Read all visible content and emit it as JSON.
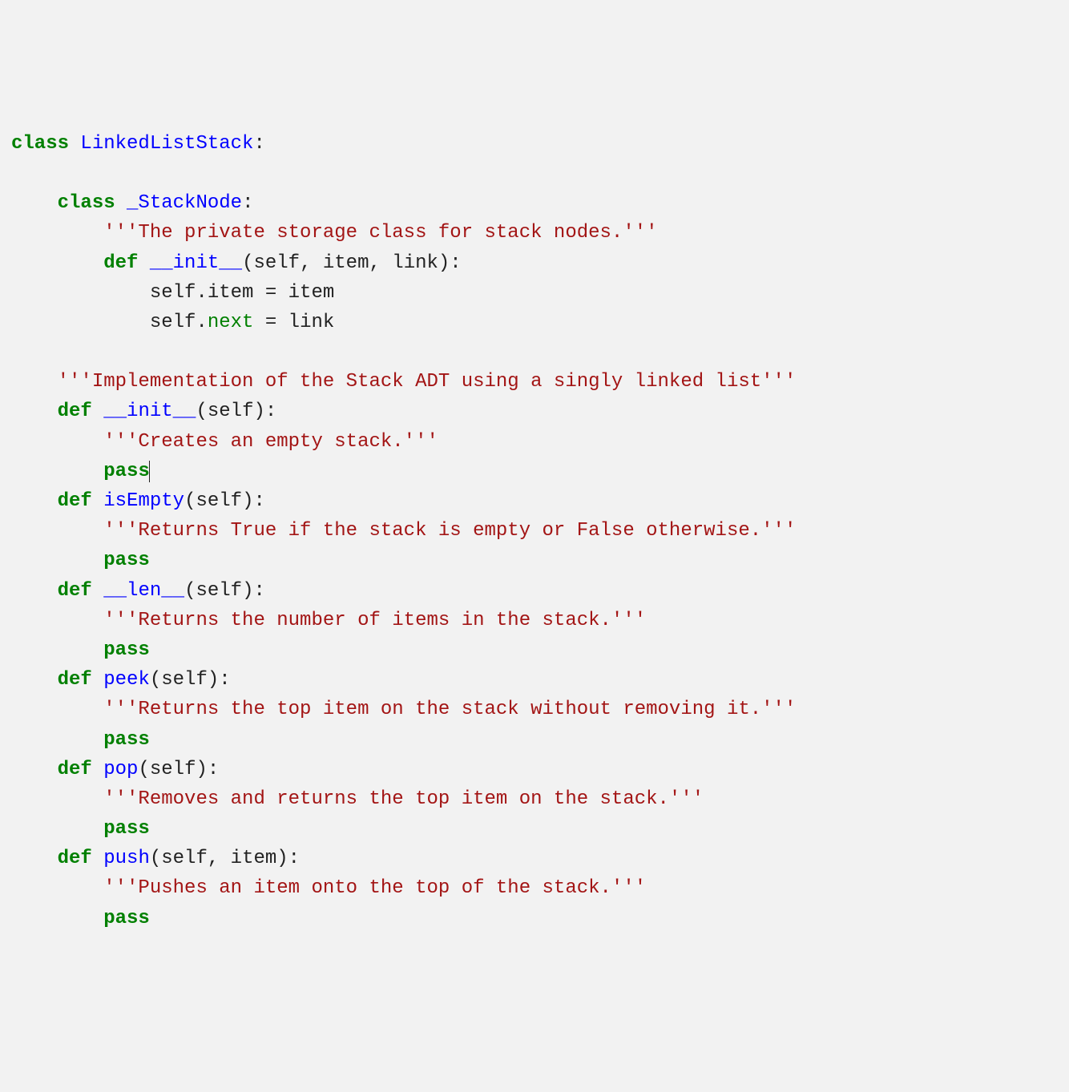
{
  "code": {
    "kw_class": "class",
    "kw_def": "def",
    "kw_pass": "pass",
    "cls_LinkedListStack": "LinkedListStack",
    "cls__StackNode": "_StackNode",
    "fn___init__": "__init__",
    "fn_isEmpty": "isEmpty",
    "fn___len__": "__len__",
    "fn_peek": "peek",
    "fn_pop": "pop",
    "fn_push": "push",
    "bi_next": "next",
    "sig_init_node": "(self, item, link):",
    "sig_self": "(self):",
    "sig_push": "(self, item):",
    "body_item": "            self.item = item",
    "body_next_prefix": "            self.",
    "body_next_suffix": " = link",
    "colon": ":",
    "doc_stacknode": "'''The private storage class for stack nodes.'''",
    "doc_impl": "'''Implementation of the Stack ADT using a singly linked list'''",
    "doc_init": "'''Creates an empty stack.'''",
    "doc_isEmpty": "'''Returns True if the stack is empty or False otherwise.'''",
    "doc_len": "'''Returns the number of items in the stack.'''",
    "doc_peek": "'''Returns the top item on the stack without removing it.'''",
    "doc_pop": "'''Removes and returns the top item on the stack.'''",
    "doc_push": "'''Pushes an item onto the top of the stack.'''"
  }
}
